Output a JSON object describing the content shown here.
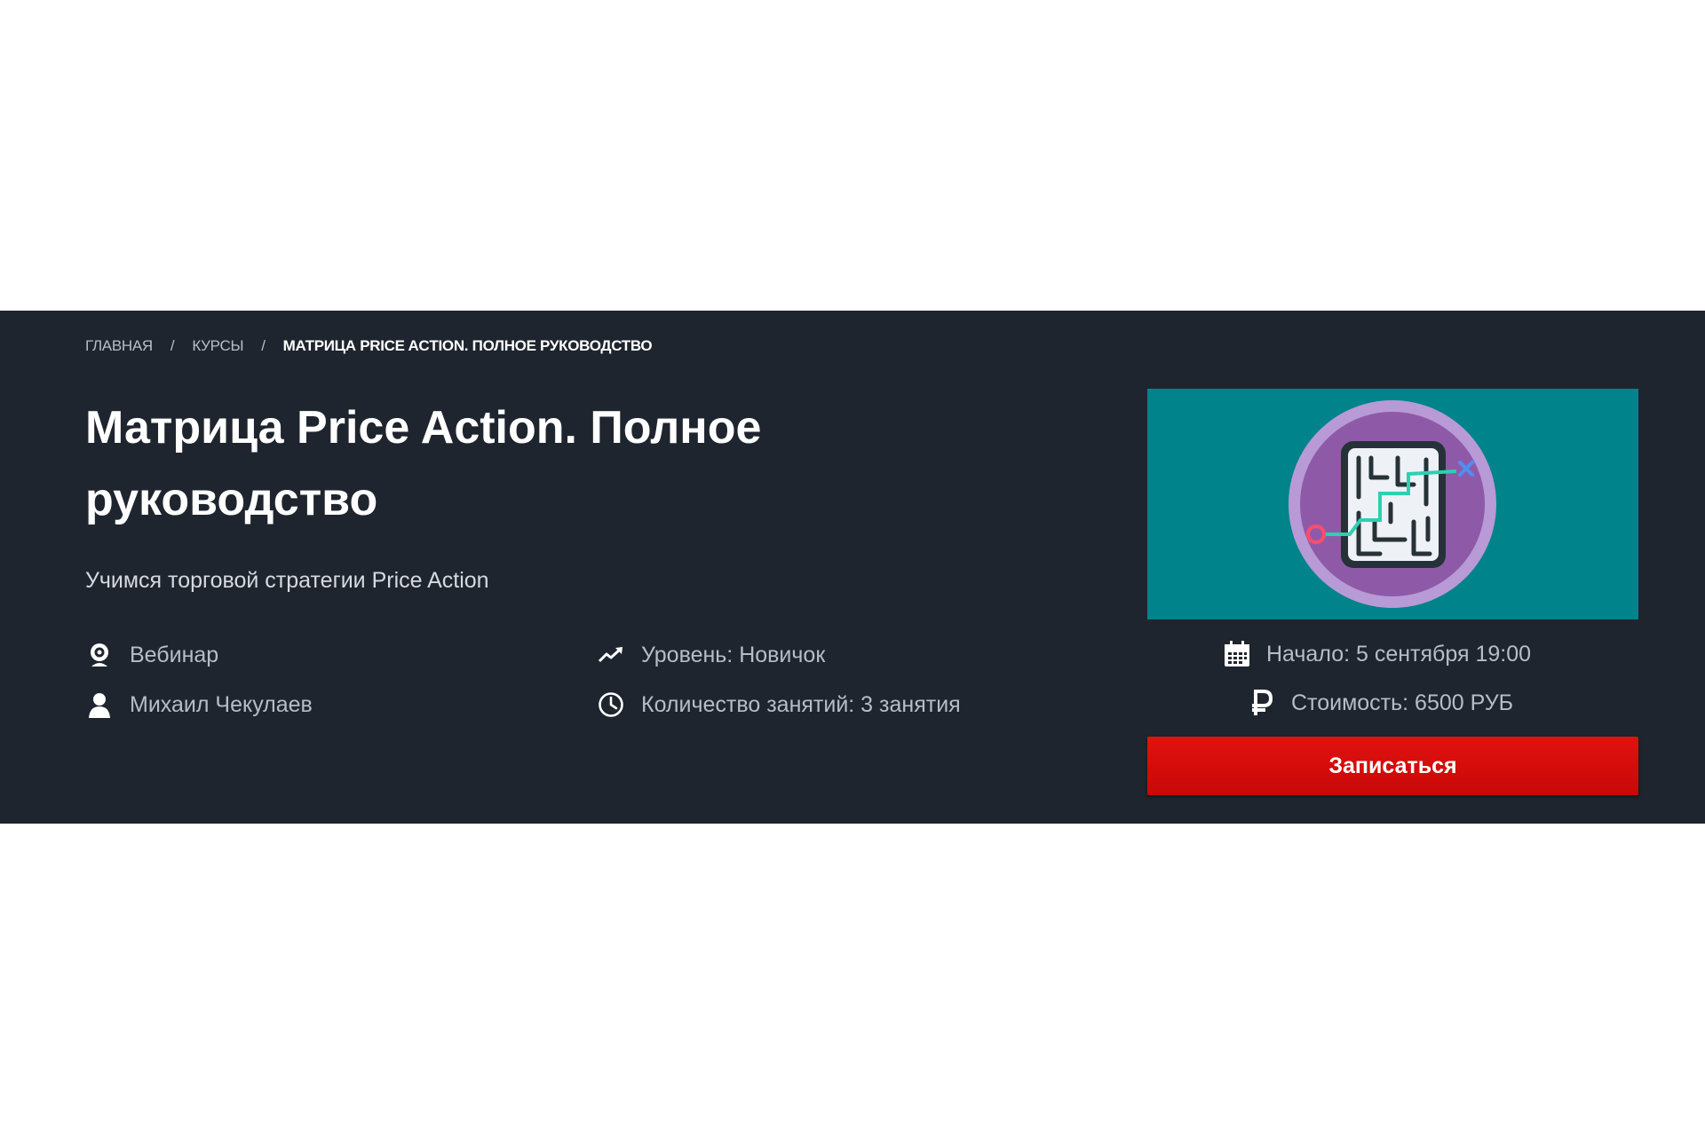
{
  "breadcrumb": {
    "home": "Главная",
    "courses": "Курсы",
    "current": "Матрица Price Action. Полное руководство",
    "separator": "/"
  },
  "course": {
    "title": "Матрица Price Action. Полное руководство",
    "subtitle": "Учимся торговой стратегии Price Action"
  },
  "meta": {
    "format": "Вебинар",
    "author": "Михаил Чекулаев",
    "level": "Уровень: Новичок",
    "lessons": "Количество занятий: 3 занятия"
  },
  "sidebar": {
    "start": "Начало: 5 сентября 19:00",
    "price": "Стоимость: 6500 РУБ",
    "enroll_label": "Записаться"
  },
  "colors": {
    "hero_bg": "#1f252e",
    "image_bg": "#00838a",
    "button": "#d40a0a",
    "maze_circle": "#8e5aa8"
  },
  "icons": {
    "format": "webcam-icon",
    "author": "user-icon",
    "level": "trending-up-icon",
    "lessons": "clock-icon",
    "start": "calendar-icon",
    "price": "ruble-icon",
    "image": "maze-icon"
  }
}
